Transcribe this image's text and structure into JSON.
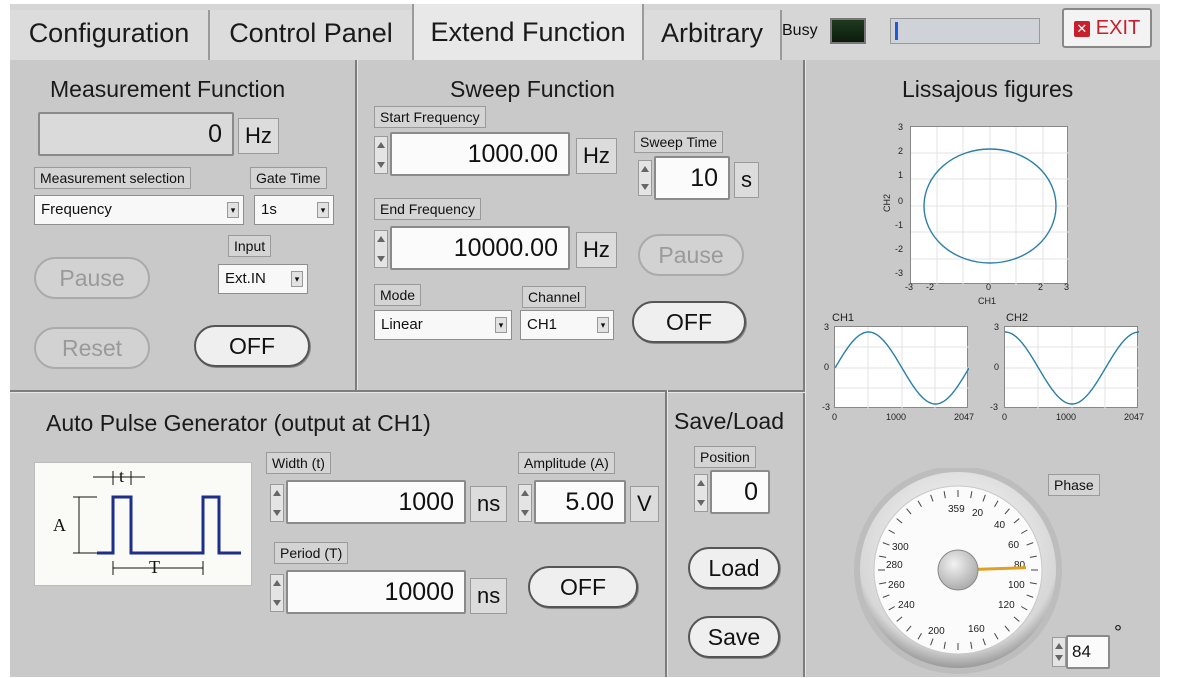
{
  "tabs": [
    "Configuration",
    "Control Panel",
    "Extend Function",
    "Arbitrary"
  ],
  "active_tab": "Extend Function",
  "status": {
    "busy_label": "Busy",
    "exit_label": "EXIT",
    "progress": 0.01
  },
  "measurement": {
    "title": "Measurement Function",
    "value": "0",
    "unit": "Hz",
    "selection_label": "Measurement selection",
    "selection_value": "Frequency",
    "gate_label": "Gate Time",
    "gate_value": "1s",
    "input_label": "Input",
    "input_value": "Ext.IN",
    "pause_label": "Pause",
    "reset_label": "Reset",
    "off_label": "OFF"
  },
  "sweep": {
    "title": "Sweep Function",
    "start_label": "Start Frequency",
    "start_value": "1000.00",
    "start_unit": "Hz",
    "end_label": "End  Frequency",
    "end_value": "10000.00",
    "end_unit": "Hz",
    "time_label": "Sweep Time",
    "time_value": "10",
    "time_unit": "s",
    "pause_label": "Pause",
    "mode_label": "Mode",
    "mode_value": "Linear",
    "channel_label": "Channel",
    "channel_value": "CH1",
    "off_label": "OFF"
  },
  "pulse": {
    "title": "Auto Pulse Generator (output at CH1)",
    "width_label": "Width (t)",
    "width_value": "1000",
    "width_unit": "ns",
    "amp_label": "Amplitude (A)",
    "amp_value": "5.00",
    "amp_unit": "V",
    "period_label": "Period (T)",
    "period_value": "10000",
    "period_unit": "ns",
    "off_label": "OFF",
    "diagram_t": "t",
    "diagram_A": "A",
    "diagram_T": "T"
  },
  "saveload": {
    "title": "Save/Load",
    "position_label": "Position",
    "position_value": "0",
    "load_label": "Load",
    "save_label": "Save"
  },
  "lissajous": {
    "title": "Lissajous figures",
    "x_ticks": [
      "-3",
      "-2",
      "0",
      "2",
      "3"
    ],
    "y_ticks": [
      "3",
      "2",
      "1",
      "0",
      "-1",
      "-2",
      "-3"
    ],
    "x_axis": "CH1",
    "y_axis": "CH2",
    "ch1_title": "CH1",
    "ch2_title": "CH2",
    "wave_x_ticks": [
      "0",
      "1000",
      "2047"
    ],
    "wave_y_ticks": [
      "3",
      "0",
      "-3"
    ]
  },
  "phase": {
    "label": "Phase",
    "value": "84",
    "unit": "°",
    "dial_labels": [
      "359",
      "20",
      "40",
      "60",
      "80",
      "100",
      "120",
      "160",
      "200",
      "240",
      "260",
      "280",
      "300"
    ]
  },
  "colors": {
    "trace": "#2a7fa8",
    "needle": "#e0a020",
    "exit": "#c71f2c"
  }
}
